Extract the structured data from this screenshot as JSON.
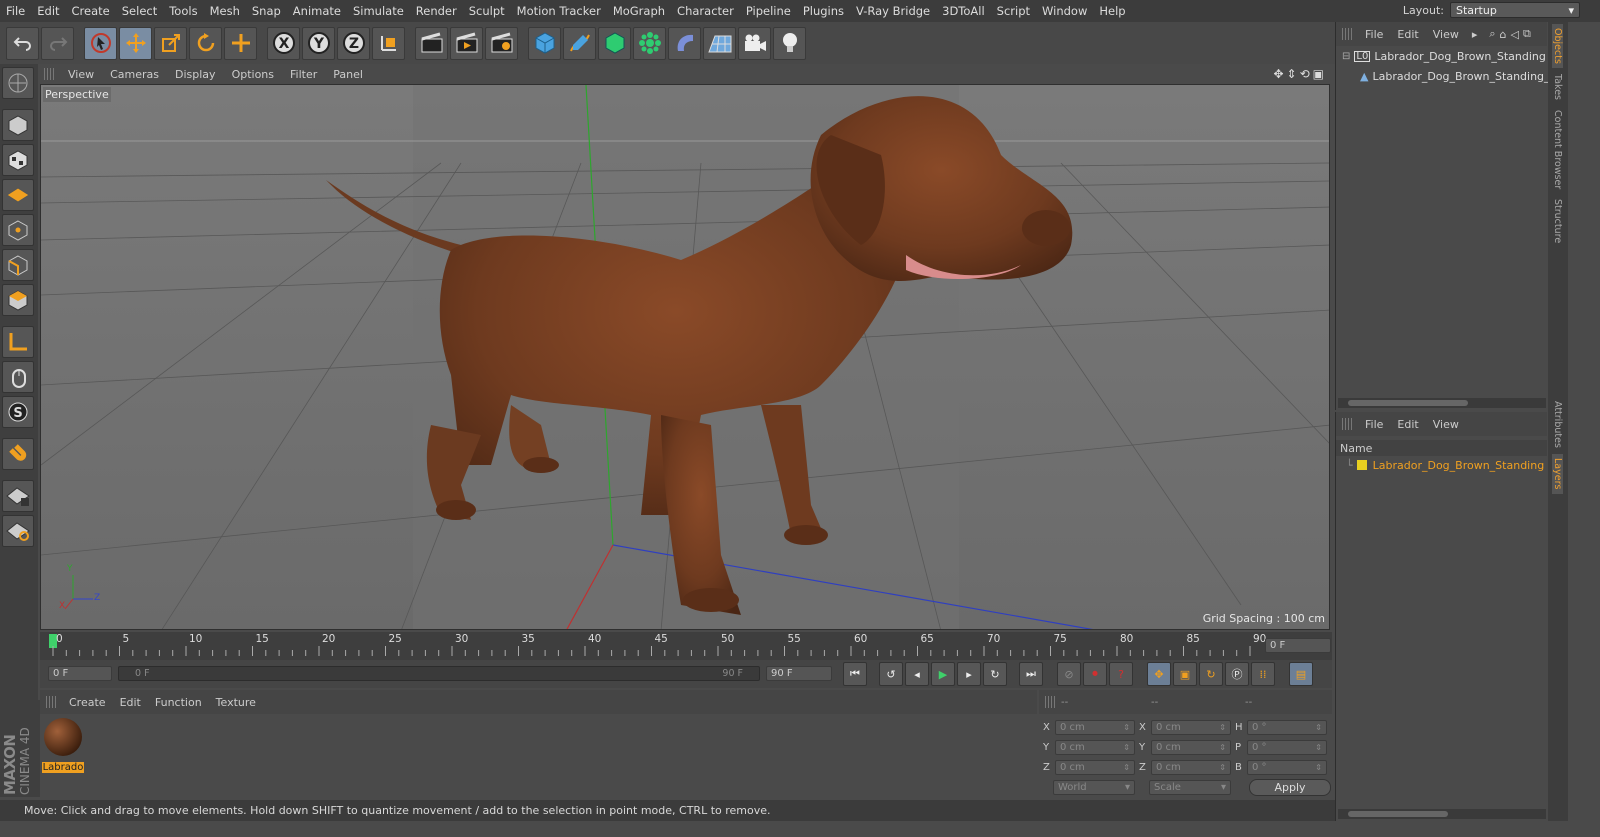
{
  "menubar": {
    "items": [
      "File",
      "Edit",
      "Create",
      "Select",
      "Tools",
      "Mesh",
      "Snap",
      "Animate",
      "Simulate",
      "Render",
      "Sculpt",
      "Motion Tracker",
      "MoGraph",
      "Character",
      "Pipeline",
      "Plugins",
      "V-Ray Bridge",
      "3DToAll",
      "Script",
      "Window",
      "Help"
    ],
    "layout_label": "Layout:",
    "layout_value": "Startup"
  },
  "viewport": {
    "menu": [
      "View",
      "Cameras",
      "Display",
      "Options",
      "Filter",
      "Panel"
    ],
    "label": "Perspective",
    "grid_spacing": "Grid Spacing : 100 cm",
    "axis": {
      "y": "Y",
      "x": "X",
      "z": "Z"
    }
  },
  "timeline": {
    "ticks": [
      "0",
      "5",
      "10",
      "15",
      "20",
      "25",
      "30",
      "35",
      "40",
      "45",
      "50",
      "55",
      "60",
      "65",
      "70",
      "75",
      "80",
      "85",
      "90"
    ],
    "current_frame": "0 F"
  },
  "timectl": {
    "start": "0 F",
    "slider_left": "0 F",
    "slider_right": "90 F",
    "end": "90 F"
  },
  "material": {
    "menu": [
      "Create",
      "Edit",
      "Function",
      "Texture"
    ],
    "item_label": "Labrado"
  },
  "coords": {
    "headers": [
      "--",
      "--",
      "--"
    ],
    "rows": [
      {
        "l1": "X",
        "v1": "0 cm",
        "l2": "X",
        "v2": "0 cm",
        "l3": "H",
        "v3": "0 °"
      },
      {
        "l1": "Y",
        "v1": "0 cm",
        "l2": "Y",
        "v2": "0 cm",
        "l3": "P",
        "v3": "0 °"
      },
      {
        "l1": "Z",
        "v1": "0 cm",
        "l2": "Z",
        "v2": "0 cm",
        "l3": "B",
        "v3": "0 °"
      }
    ],
    "mode": "World",
    "size_mode": "Scale",
    "apply": "Apply"
  },
  "status": "Move: Click and drag to move elements. Hold down SHIFT to quantize movement / add to the selection in point mode, CTRL to remove.",
  "objects": {
    "menu": [
      "File",
      "Edit",
      "View"
    ],
    "root": "Labrador_Dog_Brown_Standing",
    "child": "Labrador_Dog_Brown_Standing_"
  },
  "layers": {
    "menu": [
      "File",
      "Edit",
      "View"
    ],
    "col_name": "Name",
    "item": "Labrador_Dog_Brown_Standing"
  },
  "right_tabs": [
    "Objects",
    "Takes",
    "Content Browser",
    "Structure",
    "Attributes",
    "Layers"
  ],
  "brand": {
    "line1": "MAXON",
    "line2": "CINEMA 4D"
  }
}
